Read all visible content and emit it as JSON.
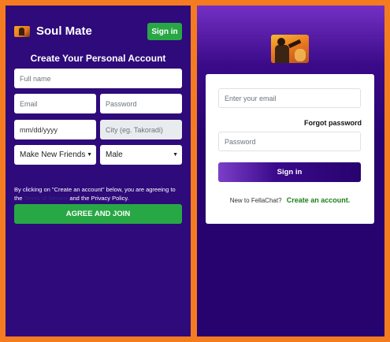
{
  "signup": {
    "brand_name": "Soul Mate",
    "signin_label": "Sign in",
    "title": "Create Your Personal Account",
    "fullname_placeholder": "Full name",
    "email_placeholder": "Email",
    "password_placeholder": "Password",
    "date_value": "mm/dd/yyyy",
    "city_placeholder": "City (eg. Takoradi)",
    "intent_value": "Make New Friends",
    "gender_value": "Male",
    "terms_prefix": "By clicking on \"Create an account\" below, you are agreeing to the",
    "terms_link": "Terms of Service",
    "terms_suffix": "and the Privacy Policy.",
    "agree_label": "AGREE AND JOIN",
    "colors": {
      "background": "#2e0a7a",
      "accent_green": "#28a745"
    }
  },
  "login": {
    "email_placeholder": "Enter your email",
    "forgot_label": "Forgot password",
    "password_placeholder": "Password",
    "signin_label": "Sign in",
    "new_text": "New to FellaChat?",
    "create_label": "Create an account.",
    "colors": {
      "background": "#26036e",
      "link_green": "#1a7f1a"
    }
  },
  "frame_color": "#f47b20",
  "icons": {
    "logo_small": "app-logo-icon",
    "logo_big": "app-logo-icon",
    "caret": "chevron-down-icon"
  }
}
